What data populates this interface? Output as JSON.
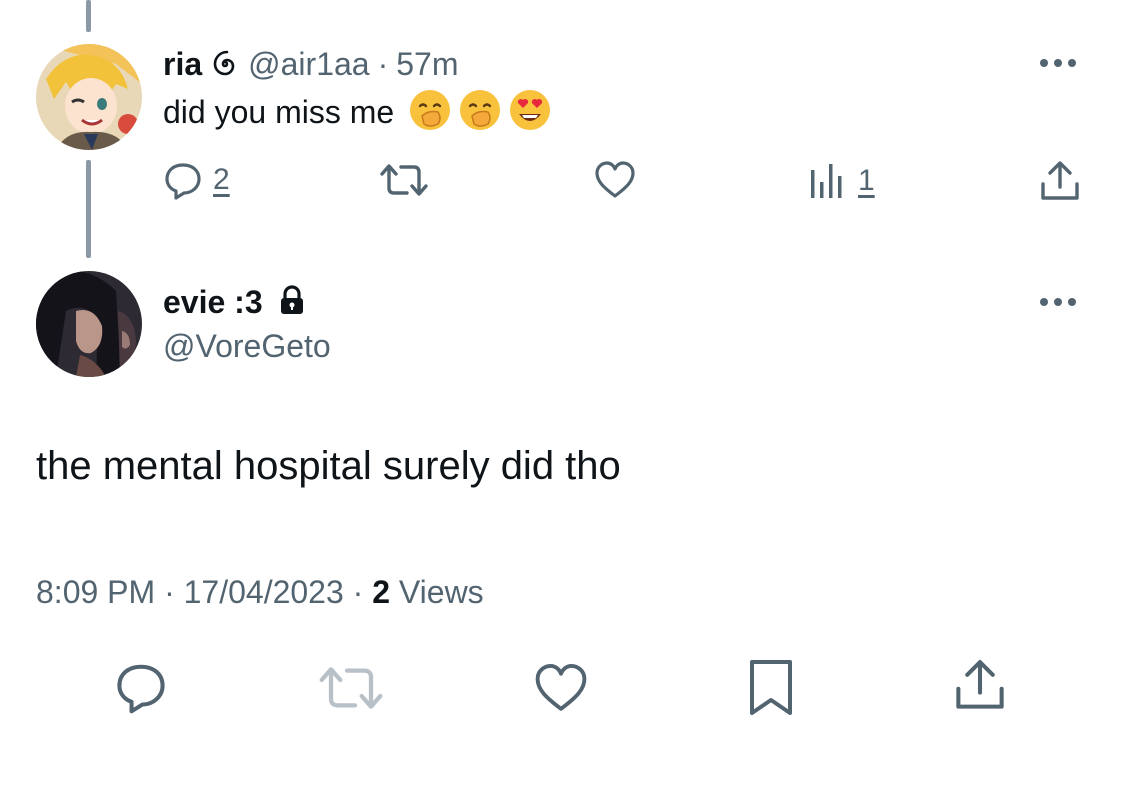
{
  "reply": {
    "display_name": "ria",
    "verified_icon": "spiral-icon",
    "handle": "@air1aa",
    "separator": "·",
    "time_ago": "57m",
    "text": "did you miss me",
    "emojis": [
      "hand-over-mouth-emoji",
      "hand-over-mouth-emoji",
      "heart-eyes-emoji"
    ],
    "actions": {
      "reply_count": "2",
      "views_count": "1"
    }
  },
  "main": {
    "display_name": "evie :3",
    "handle": "@VoreGeto",
    "text": "the mental hospital surely did tho",
    "time": "8:09 PM",
    "separator": "·",
    "date": "17/04/2023",
    "views_count": "2",
    "views_label": "Views"
  },
  "colors": {
    "text_primary": "#0f1419",
    "text_secondary": "#536471",
    "thread_line": "#8b98a5",
    "retweet_disabled": "#b8c0c8"
  }
}
